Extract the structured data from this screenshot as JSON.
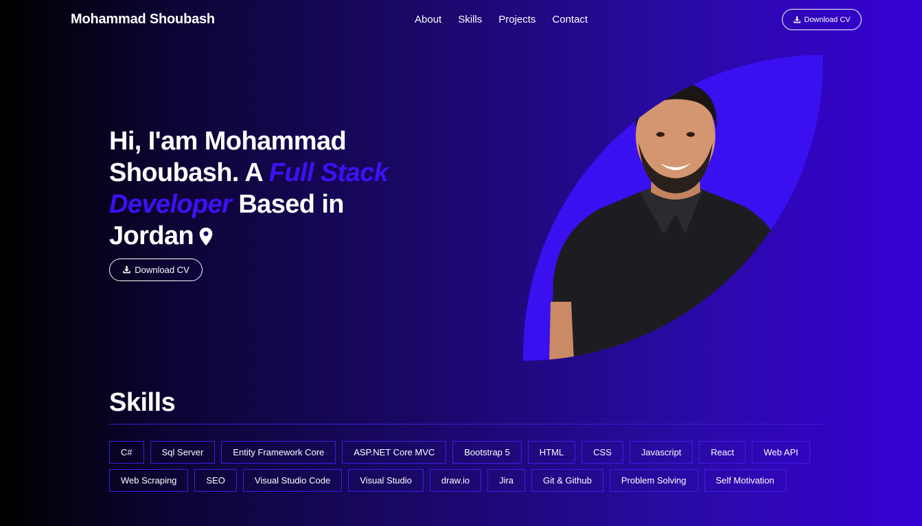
{
  "nav": {
    "brand": "Mohammad Shoubash",
    "links": [
      "About",
      "Skills",
      "Projects",
      "Contact"
    ],
    "cv_label": "Download CV"
  },
  "hero": {
    "greeting": "Hi, I'am ",
    "name": "Mohammad Shoubash",
    "mid": ". A ",
    "role": "Full Stack Developer",
    "based": " Based in ",
    "location": "Jordan",
    "cv_label": "Download CV"
  },
  "skills": {
    "title": "Skills",
    "row1": [
      "C#",
      "Sql Server",
      "Entity Framework Core",
      "ASP.NET Core MVC",
      "Bootstrap 5",
      "HTML",
      "CSS",
      "Javascript",
      "React",
      "Web API"
    ],
    "row2": [
      "Web Scraping",
      "SEO",
      "Visual Studio Code",
      "Visual Studio",
      "draw.io",
      "Jira",
      "Git & Github",
      "Problem Solving",
      "Self Motivation"
    ]
  },
  "colors": {
    "accent": "#3c12f5",
    "photo_bg": "#3a0ff0",
    "chip_border": "#3a1ee8"
  },
  "icons": {
    "download": "download-icon",
    "location": "location-pin-icon"
  }
}
